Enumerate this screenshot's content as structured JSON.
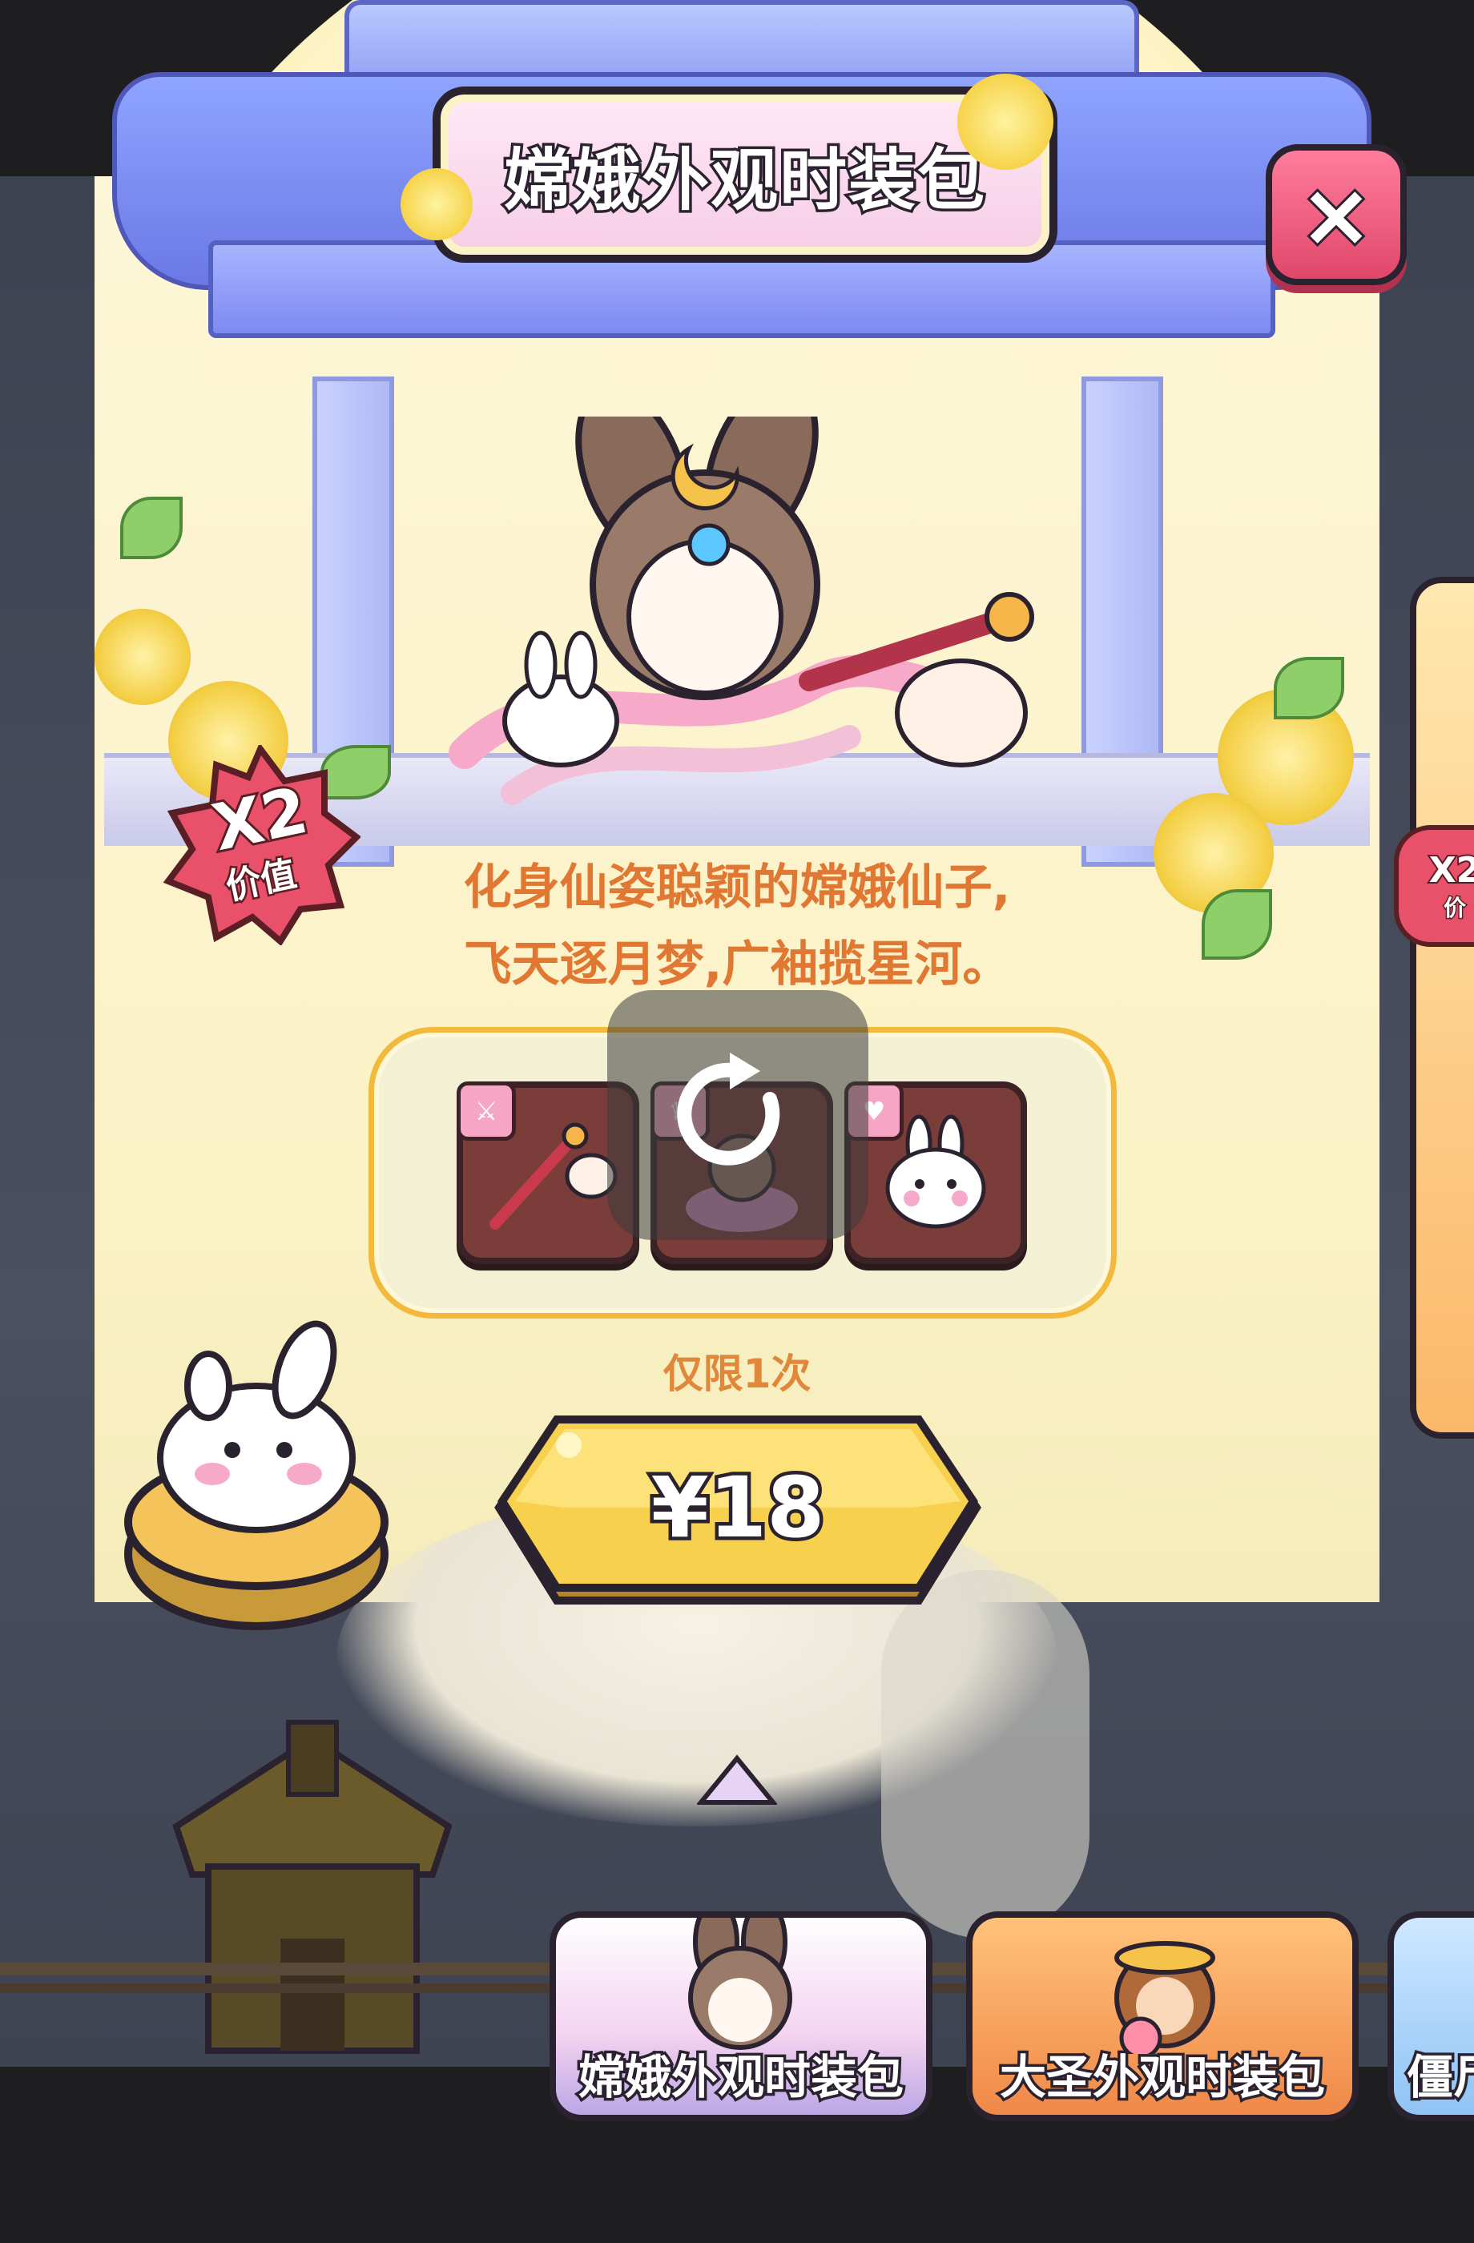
{
  "popup": {
    "title": "嫦娥外观时装包",
    "close_label": "×",
    "badge": {
      "multiplier": "X2",
      "text": "价值"
    },
    "description_line1": "化身仙姿聪颖的嫦娥仙子,",
    "description_line2": "飞天逐月梦,广袖揽星河。",
    "items": [
      {
        "icon": "staff-icon",
        "tag_icon": "weapon-tag-icon"
      },
      {
        "icon": "chang-e-outfit-icon",
        "tag_icon": "hat-tag-icon"
      },
      {
        "icon": "rabbit-pet-icon",
        "tag_icon": "pet-tag-icon"
      }
    ],
    "refresh_icon": "refresh-icon",
    "limit_text": "仅限1次",
    "price": "¥18"
  },
  "side_card": {
    "badge": "X2",
    "badge_sub": "价"
  },
  "tabs": [
    {
      "label": "嫦娥外观时装包",
      "selected": true
    },
    {
      "label": "大圣外观时装包",
      "selected": false
    },
    {
      "label": "僵尸",
      "selected": false
    }
  ],
  "colors": {
    "accent_pink": "#e0476a",
    "description_orange": "#e07834",
    "price_yellow": "#f6cf45",
    "outline": "#2b2230"
  }
}
